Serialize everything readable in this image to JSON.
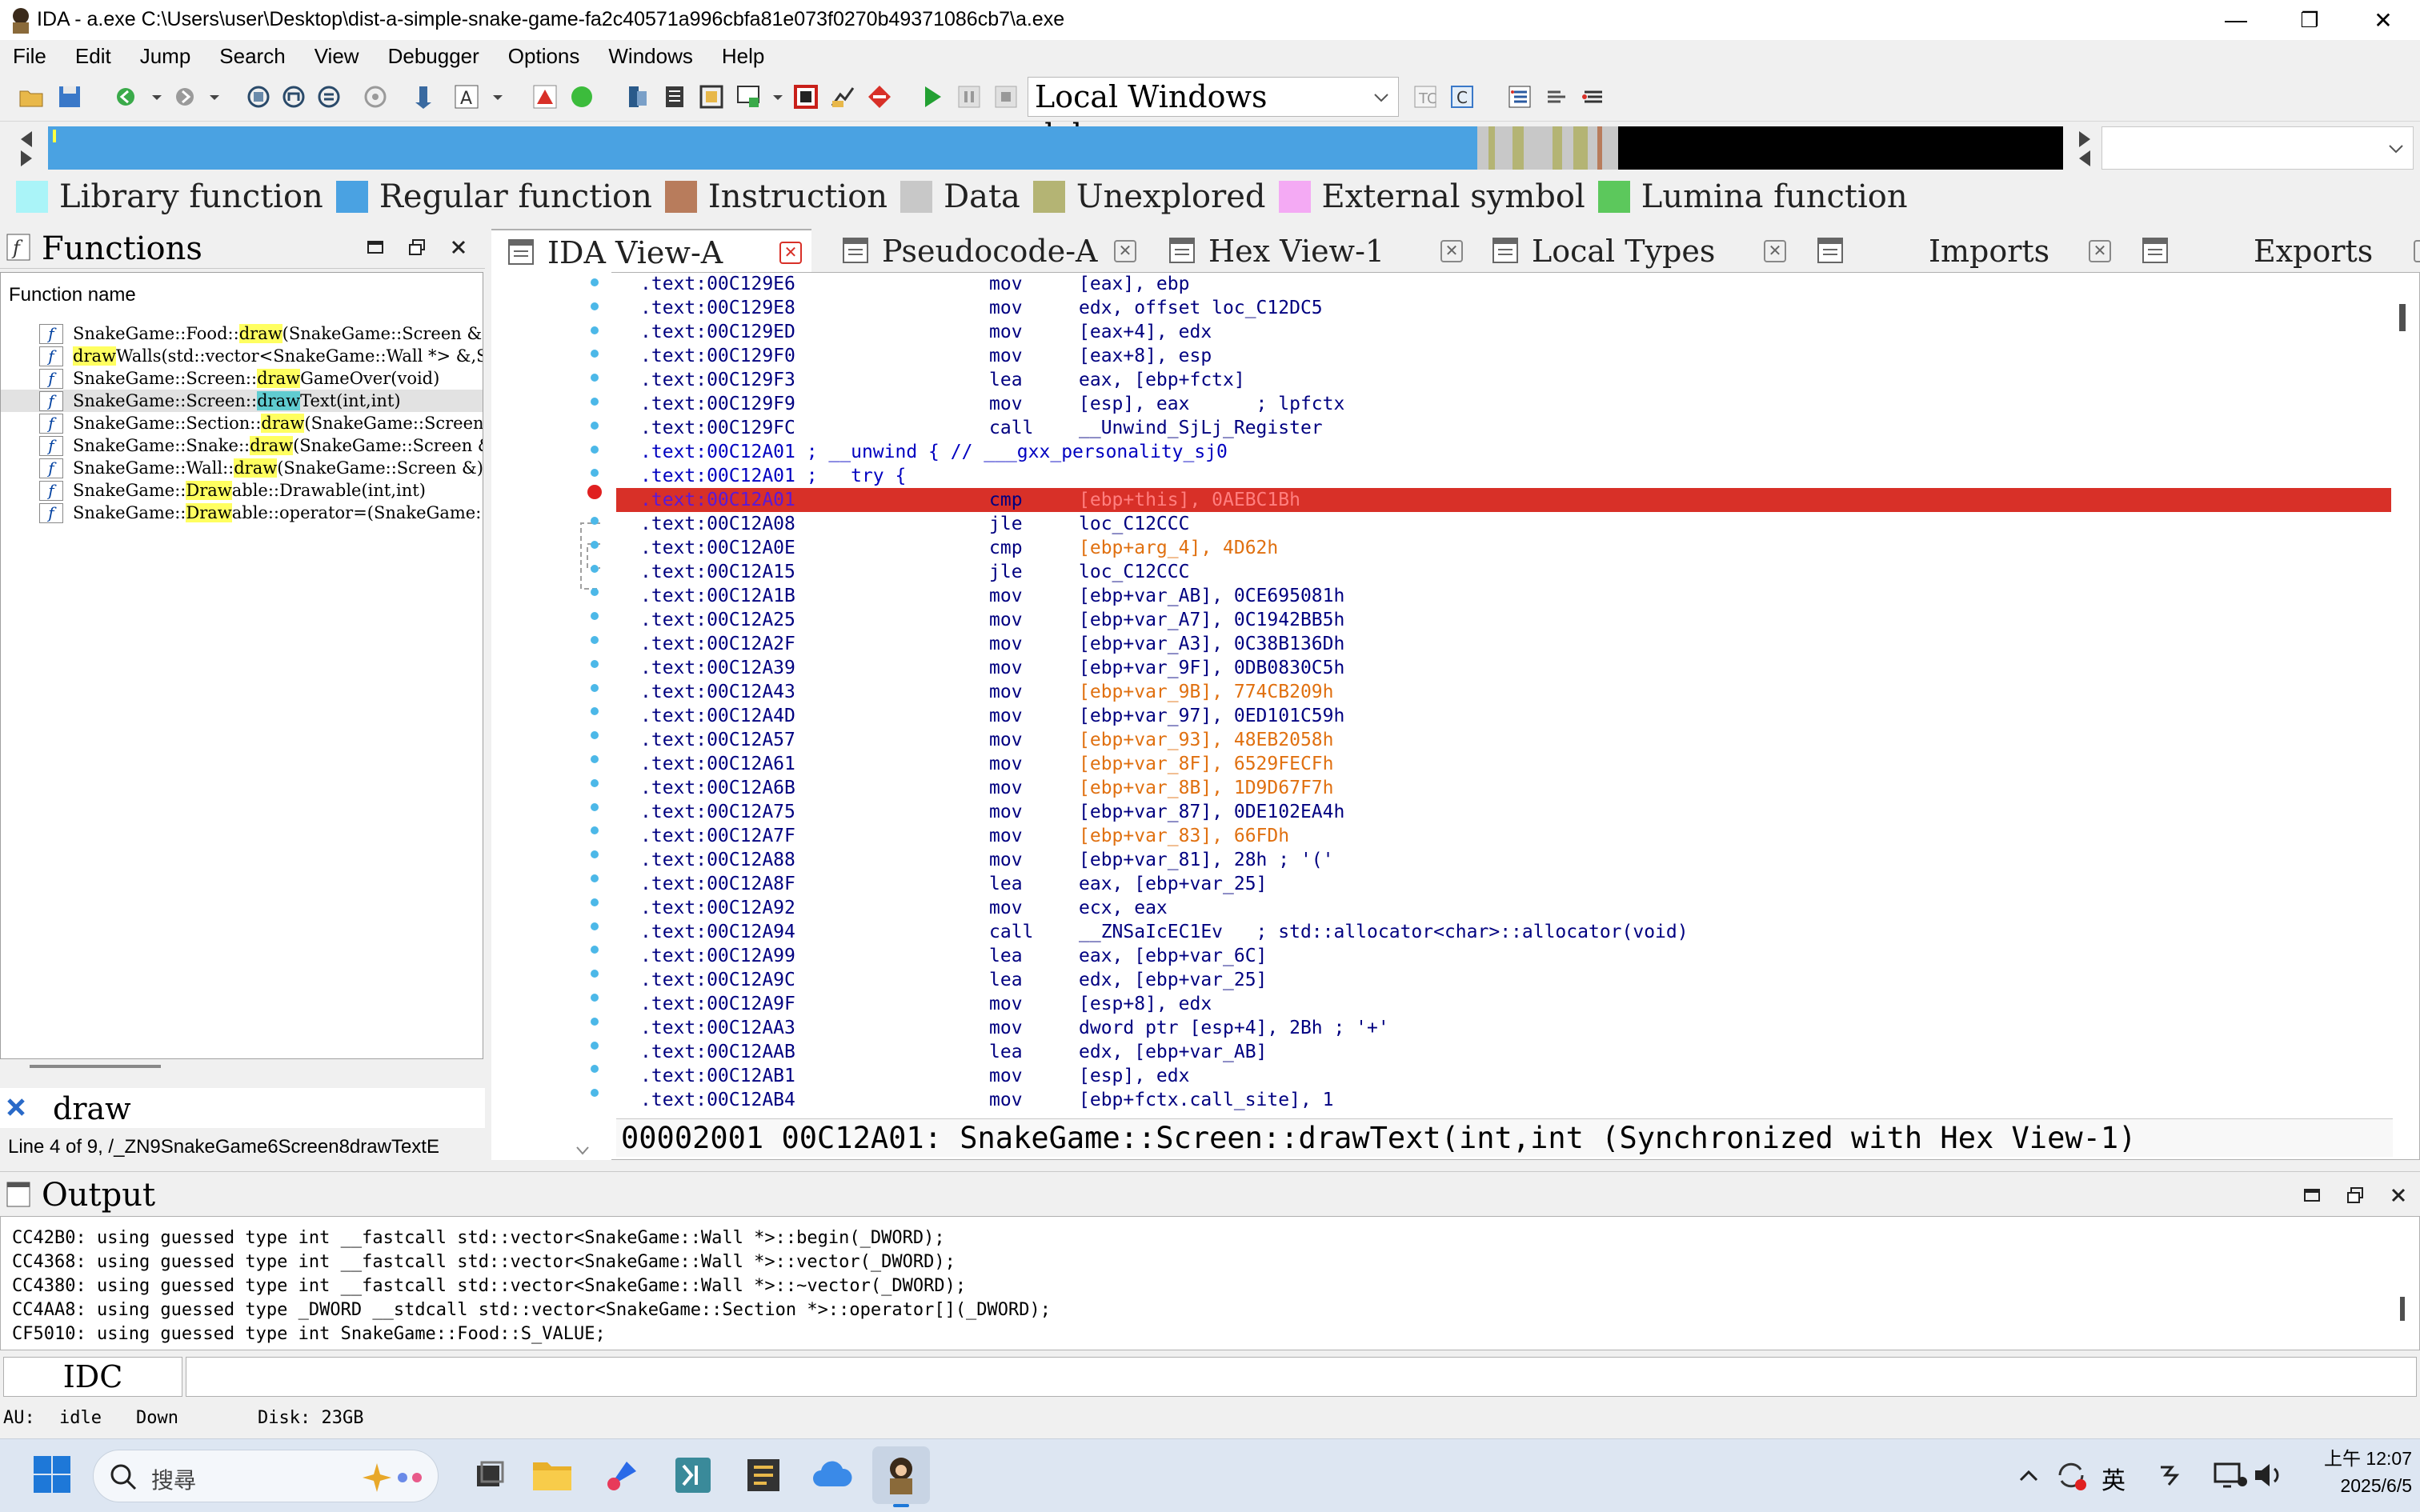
{
  "window": {
    "title": "IDA - a.exe C:\\Users\\user\\Desktop\\dist-a-simple-snake-game-fa2c40571a996cbfa81e073f0270b49371086cb7\\a.exe",
    "minimize": "—",
    "maximize": "❐",
    "close": "✕"
  },
  "menu": [
    "File",
    "Edit",
    "Jump",
    "Search",
    "View",
    "Debugger",
    "Options",
    "Windows",
    "Help"
  ],
  "toolbar": {
    "debugger": "Local Windows debugger"
  },
  "legend": [
    {
      "label": "Library function",
      "color": "#aaf4f8"
    },
    {
      "label": "Regular function",
      "color": "#4aa2e2"
    },
    {
      "label": "Instruction",
      "color": "#b87c5c"
    },
    {
      "label": "Data",
      "color": "#c8c8c8"
    },
    {
      "label": "Unexplored",
      "color": "#b4b474"
    },
    {
      "label": "External symbol",
      "color": "#f4aaf4"
    },
    {
      "label": "Lumina function",
      "color": "#5cc85c"
    }
  ],
  "functions": {
    "title": "Functions",
    "column": "Function name",
    "rows": [
      {
        "pre": "SnakeGame::Food::",
        "hl": "draw",
        "post": "(SnakeGame::Screen &)",
        "sel": false
      },
      {
        "pre": "",
        "hl": "draw",
        "post": "Walls(std::vector<SnakeGame::Wall *> &,SnakeG",
        "sel": false
      },
      {
        "pre": "SnakeGame::Screen::",
        "hl": "draw",
        "post": "GameOver(void)",
        "sel": false
      },
      {
        "pre": "SnakeGame::Screen::",
        "hl": "draw",
        "post": "Text(int,int)",
        "sel": true
      },
      {
        "pre": "SnakeGame::Section::",
        "hl": "draw",
        "post": "(SnakeGame::Screen &)",
        "sel": false
      },
      {
        "pre": "SnakeGame::Snake::",
        "hl": "draw",
        "post": "(SnakeGame::Screen &)",
        "sel": false
      },
      {
        "pre": "SnakeGame::Wall::",
        "hl": "draw",
        "post": "(SnakeGame::Screen &)",
        "sel": false
      },
      {
        "pre": "SnakeGame::",
        "hl": "Draw",
        "post": "able::Drawable(int,int)",
        "sel": false
      },
      {
        "pre": "SnakeGame::",
        "hl": "Draw",
        "post": "able::operator=(SnakeGame::Drawab",
        "sel": false
      }
    ],
    "filter": "draw",
    "status": "Line 4 of 9, /_ZN9SnakeGame6Screen8drawTextE"
  },
  "tabs": [
    "IDA View-A",
    "Pseudocode-A",
    "Hex View-1",
    "Local Types",
    "Imports",
    "Exports"
  ],
  "disasm": [
    {
      "addr": ".text:00C129E6",
      "mnem": "mov",
      "oper": "[eax], ebp"
    },
    {
      "addr": ".text:00C129E8",
      "mnem": "mov",
      "oper": "edx, offset loc_C12DC5"
    },
    {
      "addr": ".text:00C129ED",
      "mnem": "mov",
      "oper": "[eax+4], edx"
    },
    {
      "addr": ".text:00C129F0",
      "mnem": "mov",
      "oper": "[eax+8], esp"
    },
    {
      "addr": ".text:00C129F3",
      "mnem": "lea",
      "oper": "eax, [ebp+fctx]"
    },
    {
      "addr": ".text:00C129F9",
      "mnem": "mov",
      "oper": "[esp], eax      ; lpfctx"
    },
    {
      "addr": ".text:00C129FC",
      "mnem": "call",
      "oper": "__Unwind_SjLj_Register"
    },
    {
      "addr": ".text:00C12A01 ; __unwind { // ___gxx_personality_sj0",
      "mnem": "",
      "oper": ""
    },
    {
      "addr": ".text:00C12A01 ;   try {",
      "mnem": "",
      "oper": ""
    },
    {
      "addr": ".text:00C12A01",
      "mnem": "cmp",
      "oper": "[ebp+this], 0AEBC1Bh",
      "cur": true
    },
    {
      "addr": ".text:00C12A08",
      "mnem": "jle",
      "oper": "loc_C12CCC"
    },
    {
      "addr": ".text:00C12A0E",
      "mnem": "cmp",
      "oper": "[ebp+arg_4], 4D62h"
    },
    {
      "addr": ".text:00C12A15",
      "mnem": "jle",
      "oper": "loc_C12CCC"
    },
    {
      "addr": ".text:00C12A1B",
      "mnem": "mov",
      "oper": "[ebp+var_AB], 0CE695081h"
    },
    {
      "addr": ".text:00C12A25",
      "mnem": "mov",
      "oper": "[ebp+var_A7], 0C1942BB5h"
    },
    {
      "addr": ".text:00C12A2F",
      "mnem": "mov",
      "oper": "[ebp+var_A3], 0C38B136Dh"
    },
    {
      "addr": ".text:00C12A39",
      "mnem": "mov",
      "oper": "[ebp+var_9F], 0DB0830C5h"
    },
    {
      "addr": ".text:00C12A43",
      "mnem": "mov",
      "oper": "[ebp+var_9B], 774CB209h"
    },
    {
      "addr": ".text:00C12A4D",
      "mnem": "mov",
      "oper": "[ebp+var_97], 0ED101C59h"
    },
    {
      "addr": ".text:00C12A57",
      "mnem": "mov",
      "oper": "[ebp+var_93], 48EB2058h"
    },
    {
      "addr": ".text:00C12A61",
      "mnem": "mov",
      "oper": "[ebp+var_8F], 6529FECFh"
    },
    {
      "addr": ".text:00C12A6B",
      "mnem": "mov",
      "oper": "[ebp+var_8B], 1D9D67F7h"
    },
    {
      "addr": ".text:00C12A75",
      "mnem": "mov",
      "oper": "[ebp+var_87], 0DE102EA4h"
    },
    {
      "addr": ".text:00C12A7F",
      "mnem": "mov",
      "oper": "[ebp+var_83], 66FDh"
    },
    {
      "addr": ".text:00C12A88",
      "mnem": "mov",
      "oper": "[ebp+var_81], 28h ; '('"
    },
    {
      "addr": ".text:00C12A8F",
      "mnem": "lea",
      "oper": "eax, [ebp+var_25]"
    },
    {
      "addr": ".text:00C12A92",
      "mnem": "mov",
      "oper": "ecx, eax"
    },
    {
      "addr": ".text:00C12A94",
      "mnem": "call",
      "oper": "__ZNSaIcEC1Ev   ; std::allocator<char>::allocator(void)"
    },
    {
      "addr": ".text:00C12A99",
      "mnem": "lea",
      "oper": "eax, [ebp+var_6C]"
    },
    {
      "addr": ".text:00C12A9C",
      "mnem": "lea",
      "oper": "edx, [ebp+var_25]"
    },
    {
      "addr": ".text:00C12A9F",
      "mnem": "mov",
      "oper": "[esp+8], edx"
    },
    {
      "addr": ".text:00C12AA3",
      "mnem": "mov",
      "oper": "dword ptr [esp+4], 2Bh ; '+'"
    },
    {
      "addr": ".text:00C12AAB",
      "mnem": "lea",
      "oper": "edx, [ebp+var_AB]"
    },
    {
      "addr": ".text:00C12AB1",
      "mnem": "mov",
      "oper": "[esp], edx"
    },
    {
      "addr": ".text:00C12AB4",
      "mnem": "mov",
      "oper": "[ebp+fctx.call_site], 1"
    }
  ],
  "addr_status": "00002001 00C12A01: SnakeGame::Screen::drawText(int,int (Synchronized with Hex View-1)",
  "output": {
    "title": "Output",
    "lines": [
      "CC42B0: using guessed type int __fastcall std::vector<SnakeGame::Wall *>::begin(_DWORD);",
      "CC4368: using guessed type int __fastcall std::vector<SnakeGame::Wall *>::vector(_DWORD);",
      "CC4380: using guessed type int __fastcall std::vector<SnakeGame::Wall *>::~vector(_DWORD);",
      "CC4AA8: using guessed type _DWORD __stdcall std::vector<SnakeGame::Section *>::operator[](_DWORD);",
      "CF5010: using guessed type int SnakeGame::Food::S_VALUE;"
    ],
    "idc": "IDC"
  },
  "status": {
    "au": "AU:",
    "state": "idle",
    "dir": "Down",
    "disk": "Disk: 23GB"
  },
  "taskbar": {
    "search": "搜尋",
    "ime": "英",
    "time": "上午 12:07",
    "date": "2025/6/5"
  }
}
